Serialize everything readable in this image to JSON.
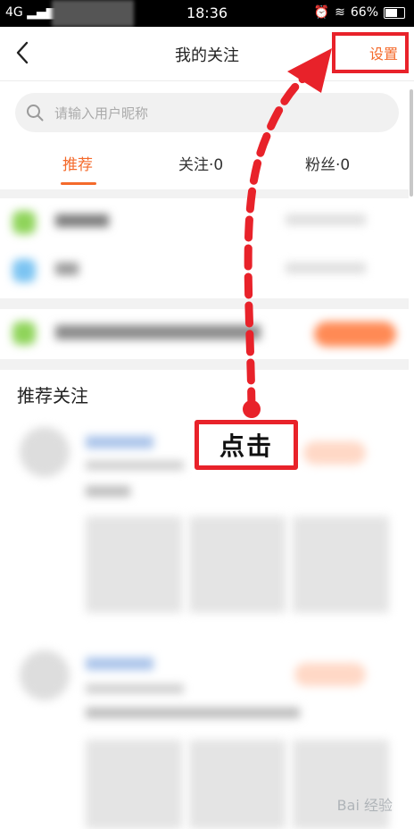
{
  "status_bar": {
    "network": "4G",
    "time": "18:36",
    "battery": "66%"
  },
  "header": {
    "title": "我的关注",
    "settings_label": "设置"
  },
  "search": {
    "placeholder": "请输入用户昵称"
  },
  "tabs": [
    {
      "label": "推荐",
      "active": true
    },
    {
      "label": "关注·0",
      "active": false
    },
    {
      "label": "粉丝·0",
      "active": false
    }
  ],
  "recommend_section": {
    "title": "推荐关注"
  },
  "annotation": {
    "label": "点击"
  },
  "watermark": {
    "text": "Bai 经验"
  },
  "colors": {
    "accent": "#f46a2b",
    "annotation_red": "#e8222a"
  }
}
